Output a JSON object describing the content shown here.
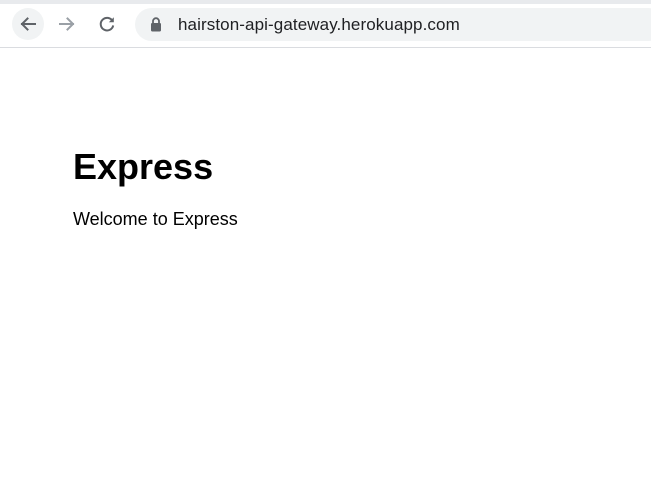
{
  "browser": {
    "url": "hairston-api-gateway.herokuapp.com",
    "icons": {
      "back": "arrow-left-icon",
      "forward": "arrow-right-icon",
      "reload": "reload-icon",
      "lock": "lock-icon"
    },
    "colors": {
      "toolbar_bg": "#ffffff",
      "omnibox_bg": "#f1f3f4",
      "icon_active": "#5f6368",
      "icon_disabled": "#9aa0a6"
    }
  },
  "page": {
    "title": "Express",
    "paragraph": "Welcome to Express"
  }
}
